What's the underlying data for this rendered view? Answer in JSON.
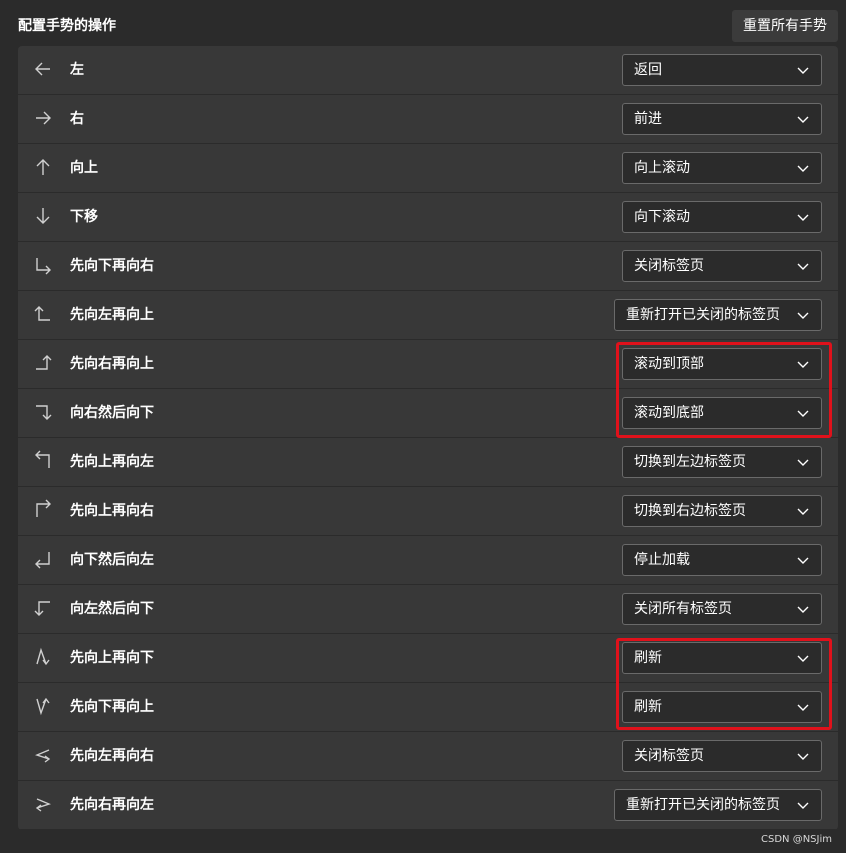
{
  "header": {
    "title": "配置手势的操作",
    "reset_label": "重置所有手势"
  },
  "gestures": [
    {
      "icon": "arrow-left-icon",
      "label": "左",
      "value": "返回"
    },
    {
      "icon": "arrow-right-icon",
      "label": "右",
      "value": "前进"
    },
    {
      "icon": "arrow-up-icon",
      "label": "向上",
      "value": "向上滚动"
    },
    {
      "icon": "arrow-down-icon",
      "label": "下移",
      "value": "向下滚动"
    },
    {
      "icon": "down-then-right-icon",
      "label": "先向下再向右",
      "value": "关闭标签页"
    },
    {
      "icon": "left-then-up-icon",
      "label": "先向左再向上",
      "value": "重新打开已关闭的标签页"
    },
    {
      "icon": "right-then-up-icon",
      "label": "先向右再向上",
      "value": "滚动到顶部"
    },
    {
      "icon": "right-then-down-icon",
      "label": "向右然后向下",
      "value": "滚动到底部"
    },
    {
      "icon": "up-then-left-icon",
      "label": "先向上再向左",
      "value": "切换到左边标签页"
    },
    {
      "icon": "up-then-right-icon",
      "label": "先向上再向右",
      "value": "切换到右边标签页"
    },
    {
      "icon": "down-then-left-icon",
      "label": "向下然后向左",
      "value": "停止加载"
    },
    {
      "icon": "left-then-down-icon",
      "label": "向左然后向下",
      "value": "关闭所有标签页"
    },
    {
      "icon": "up-then-down-icon",
      "label": "先向上再向下",
      "value": "刷新"
    },
    {
      "icon": "down-then-up-icon",
      "label": "先向下再向上",
      "value": "刷新"
    },
    {
      "icon": "left-then-right-icon",
      "label": "先向左再向右",
      "value": "关闭标签页"
    },
    {
      "icon": "right-then-left-icon",
      "label": "先向右再向左",
      "value": "重新打开已关闭的标签页"
    }
  ],
  "watermark": "CSDN @NSJim",
  "colors": {
    "background": "#2b2b2b",
    "panel": "#383838",
    "highlight": "#e0111b"
  }
}
